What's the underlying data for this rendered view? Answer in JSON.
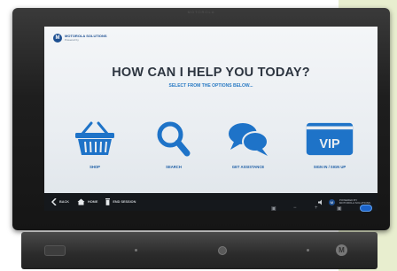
{
  "device": {
    "top_brand": "MOTOROLA"
  },
  "screen": {
    "logo": {
      "mark": "M",
      "line1": "MOTOROLA SOLUTIONS",
      "line2": "Powered by"
    },
    "title": "HOW CAN I HELP YOU TODAY?",
    "subtitle": "SELECT FROM THE OPTIONS BELOW...",
    "options": [
      {
        "label": "SHOP",
        "icon": "shopping-basket-icon"
      },
      {
        "label": "SEARCH",
        "icon": "magnifier-icon"
      },
      {
        "label": "GET ASSISTANCE",
        "icon": "chat-bubbles-icon"
      },
      {
        "label": "SIGN IN / SIGN UP",
        "icon": "vip-card-icon",
        "badge": "VIP"
      }
    ],
    "navbar": {
      "back": "BACK",
      "home": "HOME",
      "end_session": "END SESSION",
      "brand_line1": "POWERED BY",
      "brand_line2": "MOTOROLA SOLUTIONS"
    }
  },
  "colors": {
    "accent_blue": "#1f5fa6",
    "title": "#2d3540",
    "subtitle": "#2a7bc4",
    "bezel": "#1e1e1e"
  }
}
